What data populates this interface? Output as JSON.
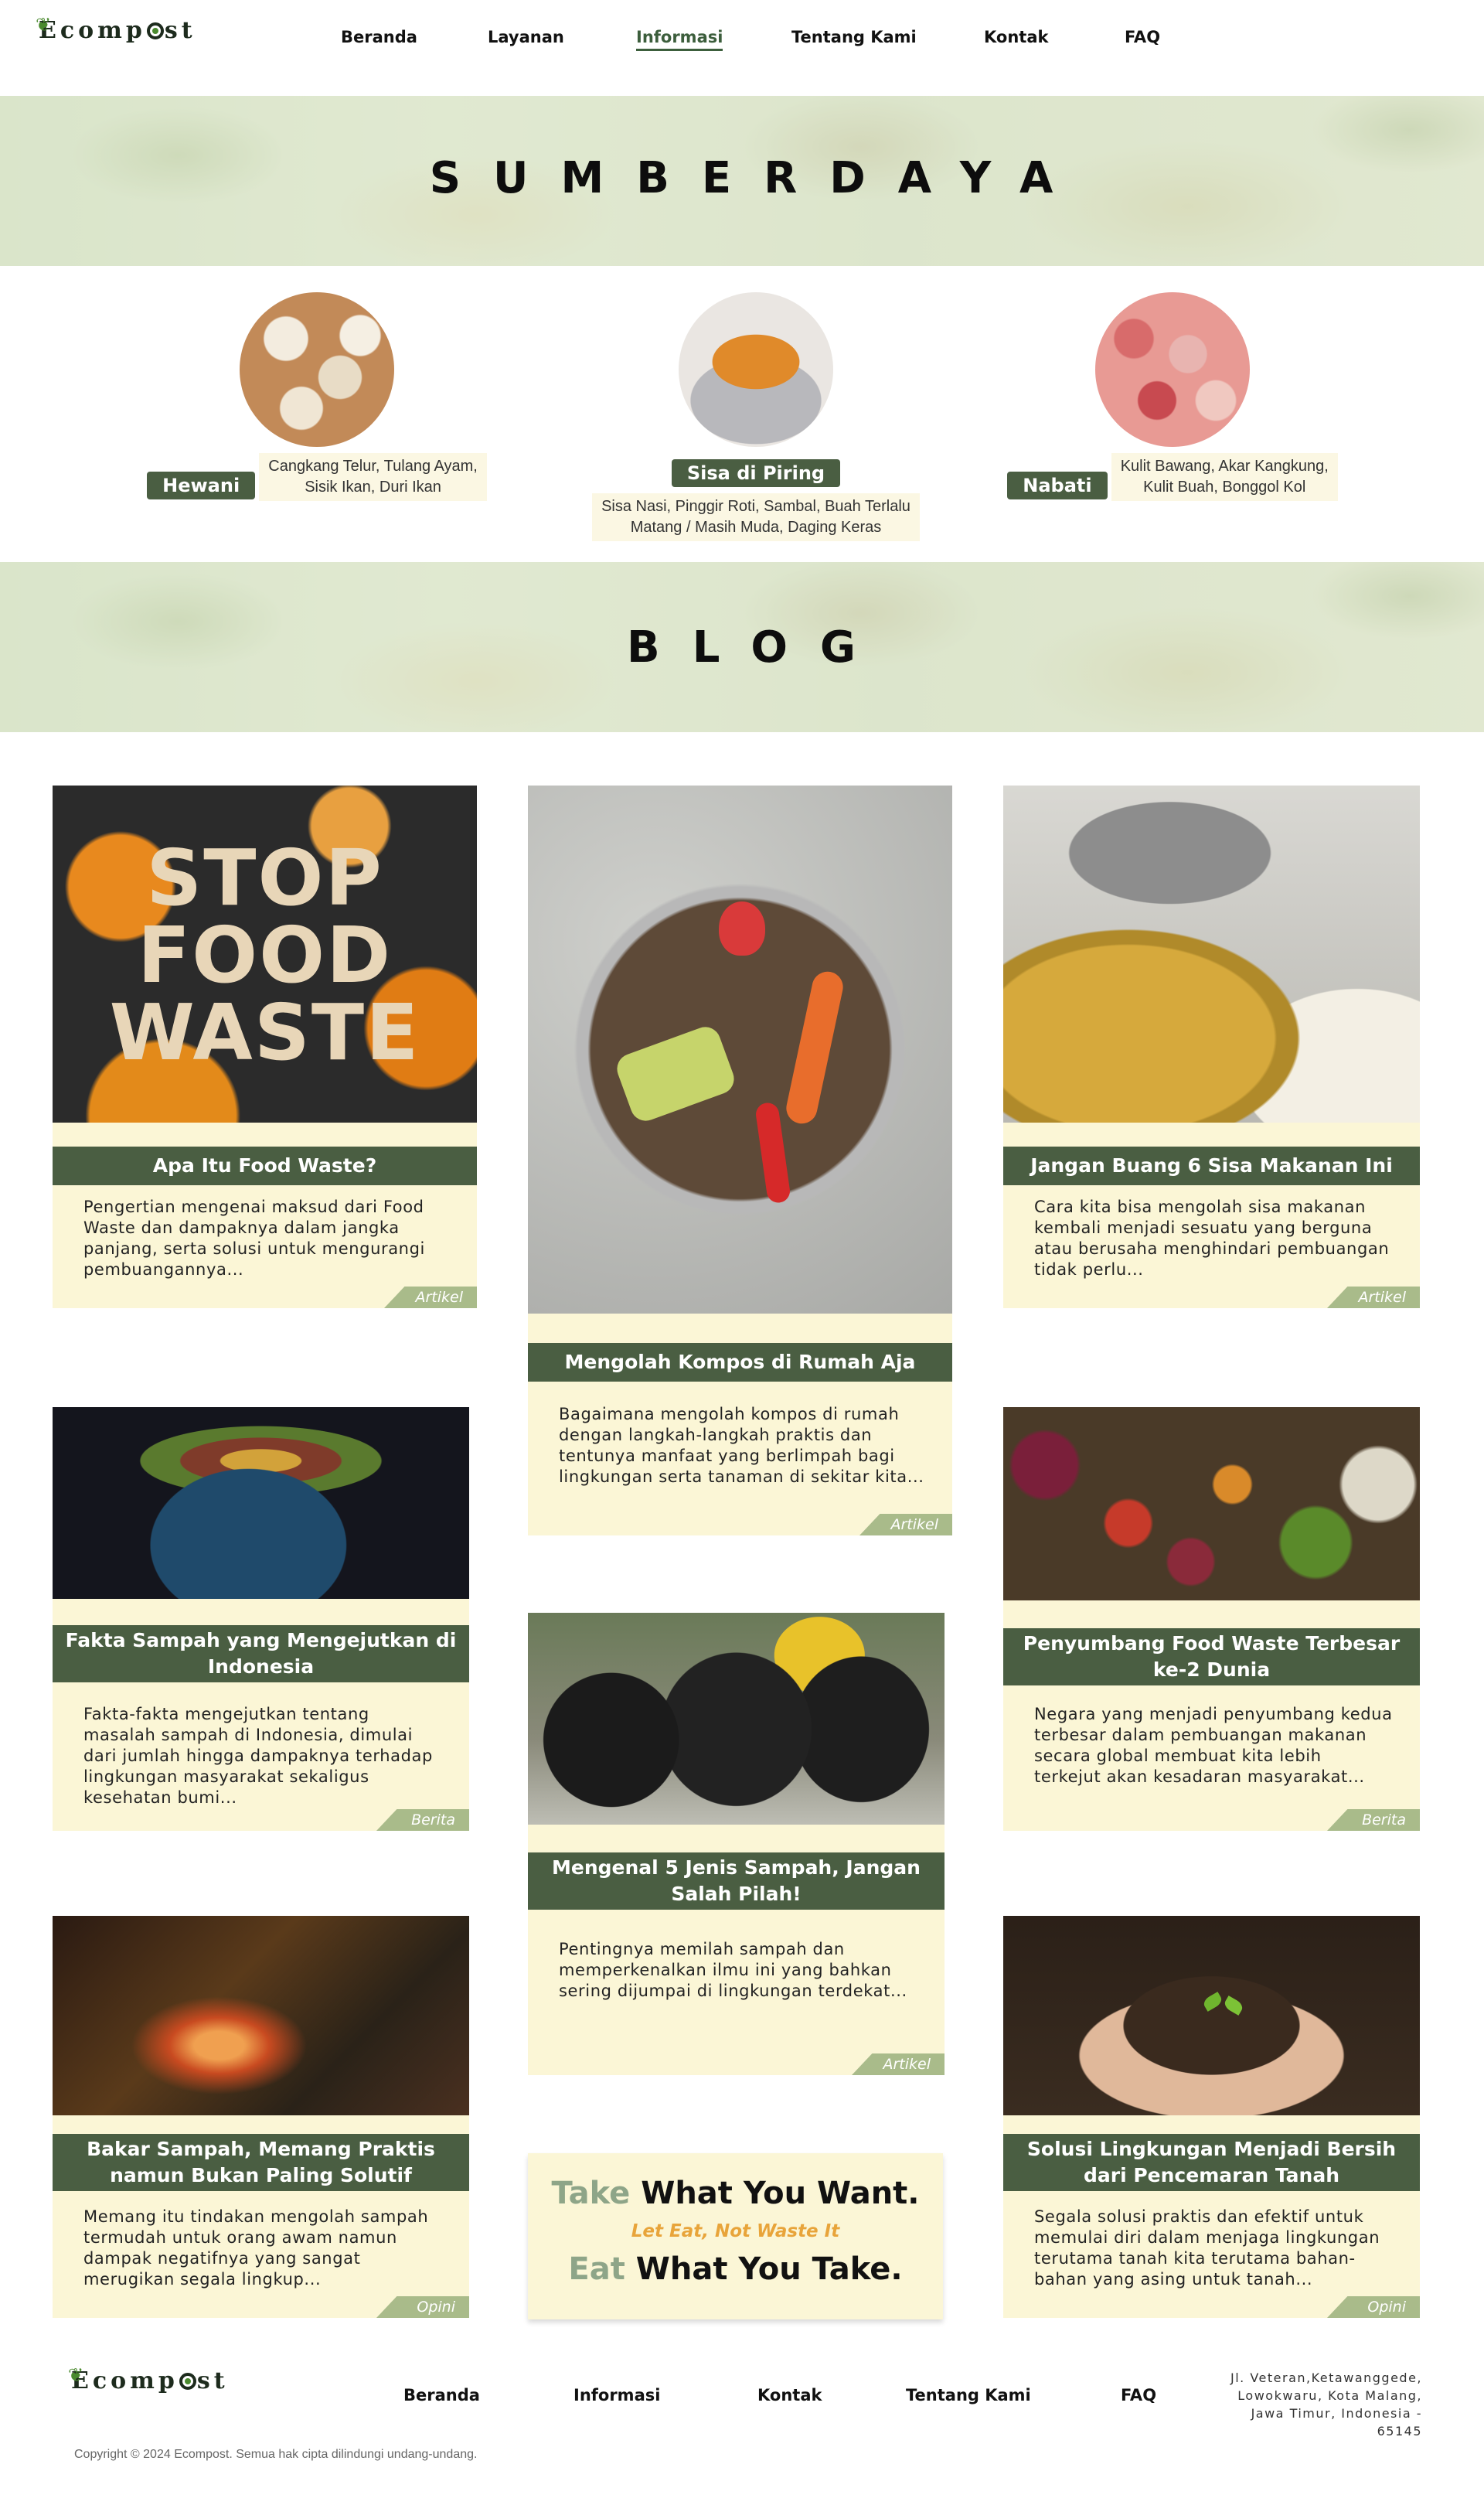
{
  "header": {
    "logo_text": "Ecompost",
    "nav": [
      "Beranda",
      "Layanan",
      "Informasi",
      "Tentang Kami",
      "Kontak",
      "FAQ"
    ],
    "active_nav": "Informasi"
  },
  "resources_section": {
    "title": "SUMBERDAYA",
    "items": [
      {
        "label": "Hewani",
        "desc_line1": "Cangkang Telur, Tulang Ayam,",
        "desc_line2": "Sisik Ikan, Duri Ikan"
      },
      {
        "label": "Sisa di Piring",
        "desc_line1": "Sisa Nasi, Pinggir Roti, Sambal, Buah Terlalu",
        "desc_line2": "Matang / Masih Muda, Daging Keras"
      },
      {
        "label": "Nabati",
        "desc_line1": "Kulit Bawang, Akar Kangkung,",
        "desc_line2": "Kulit Buah, Bonggol Kol"
      }
    ]
  },
  "blog_section": {
    "title": "BLOG",
    "posts": [
      {
        "title": "Apa Itu Food Waste?",
        "body": "Pengertian mengenai maksud dari Food Waste dan dampaknya dalam jangka panjang, serta solusi untuk mengurangi pembuangannya...",
        "tag": "Artikel",
        "image_text": "STOP FOOD WASTE"
      },
      {
        "title": "Mengolah Kompos di Rumah Aja",
        "body": "Bagaimana mengolah kompos di rumah dengan langkah-langkah praktis dan tentunya manfaat yang berlimpah bagi lingkungan serta tanaman di sekitar kita...",
        "tag": "Artikel"
      },
      {
        "title": "Jangan Buang 6 Sisa Makanan Ini",
        "body": "Cara kita bisa mengolah sisa makanan kembali menjadi sesuatu yang berguna atau berusaha menghindari pembuangan tidak perlu...",
        "tag": "Artikel"
      },
      {
        "title": "Fakta Sampah yang Mengejutkan di Indonesia",
        "body": "Fakta-fakta mengejutkan tentang masalah sampah di Indonesia, dimulai dari jumlah hingga dampaknya terhadap lingkungan masyarakat sekaligus kesehatan bumi...",
        "tag": "Berita"
      },
      {
        "title": "Mengenal 5 Jenis Sampah, Jangan Salah Pilah!",
        "body": "Pentingnya memilah sampah dan memperkenalkan ilmu ini yang bahkan sering dijumpai di lingkungan terdekat...",
        "tag": "Artikel"
      },
      {
        "title": "Penyumbang Food Waste Terbesar ke-2 Dunia",
        "body": "Negara yang menjadi penyumbang kedua terbesar dalam pembuangan makanan secara global membuat kita lebih terkejut akan kesadaran masyarakat...",
        "tag": "Berita"
      },
      {
        "title": "Bakar Sampah, Memang Praktis namun Bukan Paling Solutif",
        "body": "Memang itu tindakan mengolah sampah termudah untuk orang awam namun dampak negatifnya yang sangat merugikan segala lingkup...",
        "tag": "Opini"
      },
      {
        "title": "Solusi Lingkungan Menjadi Bersih dari Pencemaran Tanah",
        "body": "Segala solusi praktis dan efektif untuk memulai diri dalam menjaga lingkungan terutama tanah kita terutama bahan-bahan yang asing untuk tanah...",
        "tag": "Opini"
      }
    ],
    "quote": {
      "line1_accent": "Take",
      "line1_rest": " What You Want.",
      "sub": "Let Eat, Not Waste It",
      "line2_accent": "Eat",
      "line2_rest": " What You Take."
    }
  },
  "footer": {
    "logo_text": "Ecompost",
    "nav": [
      "Beranda",
      "Informasi",
      "Kontak",
      "Tentang Kami",
      "FAQ"
    ],
    "address": "Jl. Veteran,Ketawanggede, Lowokwaru, Kota Malang, Jawa Timur, Indonesia - 65145",
    "copyright": "Copyright © 2024 Ecompost. Semua hak cipta dilindungi undang-undang."
  },
  "colors": {
    "accent_green": "#4a5e42",
    "card_cream": "#fbf6d6",
    "tag_green": "#a9bb8a",
    "quote_orange": "#e8a43a"
  }
}
